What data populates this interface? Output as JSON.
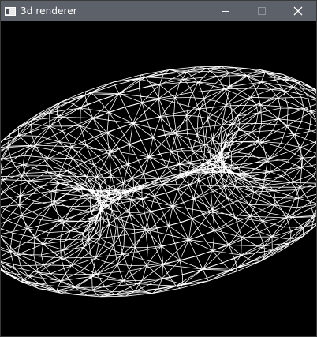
{
  "window": {
    "title": "3d renderer",
    "icon": "window-app-icon",
    "controls": {
      "minimize_icon": "minimize-icon",
      "maximize_icon": "maximize-icon",
      "close_icon": "close-icon"
    }
  },
  "viewport": {
    "background": "#000000",
    "wire_color": "#ffffff",
    "object": "torus",
    "render_mode": "wireframe"
  }
}
